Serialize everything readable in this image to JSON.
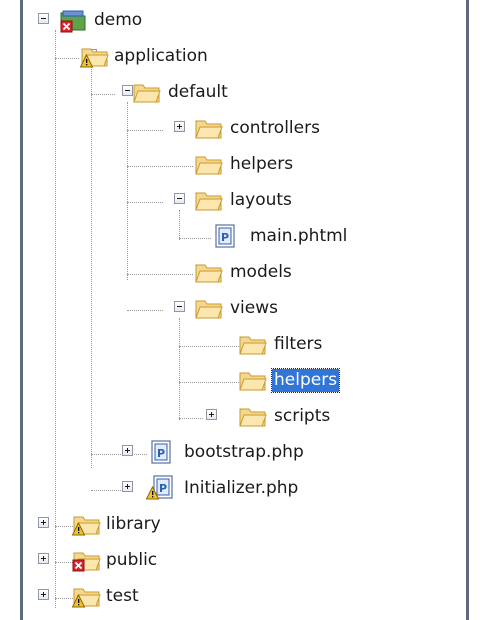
{
  "tree": {
    "nodes": [
      {
        "id": "demo",
        "label": "demo",
        "icon": "php-project-error-icon",
        "expander": "minus"
      },
      {
        "id": "application",
        "label": "application",
        "icon": "folder-warning-icon",
        "expander": "minus"
      },
      {
        "id": "default",
        "label": "default",
        "icon": "folder-open-icon",
        "expander": "minus"
      },
      {
        "id": "controllers",
        "label": "controllers",
        "icon": "folder-open-icon",
        "expander": "plus"
      },
      {
        "id": "helpers",
        "label": "helpers",
        "icon": "folder-open-icon",
        "expander": "none"
      },
      {
        "id": "layouts",
        "label": "layouts",
        "icon": "folder-open-icon",
        "expander": "minus"
      },
      {
        "id": "main-phtml",
        "label": "main.phtml",
        "icon": "php-file-icon",
        "expander": "none"
      },
      {
        "id": "models",
        "label": "models",
        "icon": "folder-open-icon",
        "expander": "none"
      },
      {
        "id": "views",
        "label": "views",
        "icon": "folder-open-icon",
        "expander": "minus"
      },
      {
        "id": "filters",
        "label": "filters",
        "icon": "folder-open-icon",
        "expander": "none"
      },
      {
        "id": "views-helpers",
        "label": "helpers",
        "icon": "folder-open-icon",
        "expander": "none",
        "selected": true
      },
      {
        "id": "scripts",
        "label": "scripts",
        "icon": "folder-open-icon",
        "expander": "plus"
      },
      {
        "id": "bootstrap-php",
        "label": "bootstrap.php",
        "icon": "php-file-icon",
        "expander": "plus"
      },
      {
        "id": "initializer-php",
        "label": "Initializer.php",
        "icon": "php-file-warning-icon",
        "expander": "plus"
      },
      {
        "id": "library",
        "label": "library",
        "icon": "folder-warning-icon",
        "expander": "plus"
      },
      {
        "id": "public",
        "label": "public",
        "icon": "folder-error-icon",
        "expander": "plus"
      },
      {
        "id": "test",
        "label": "test",
        "icon": "folder-warning-icon",
        "expander": "plus"
      }
    ]
  },
  "colors": {
    "selection": "#3175d6",
    "frame": "#5f6a7d",
    "folder": "#f5d88f",
    "folder_stroke": "#c99a2e",
    "warning": "#f2c12e",
    "error": "#d9262c",
    "php_blue": "#2b5fb0"
  }
}
